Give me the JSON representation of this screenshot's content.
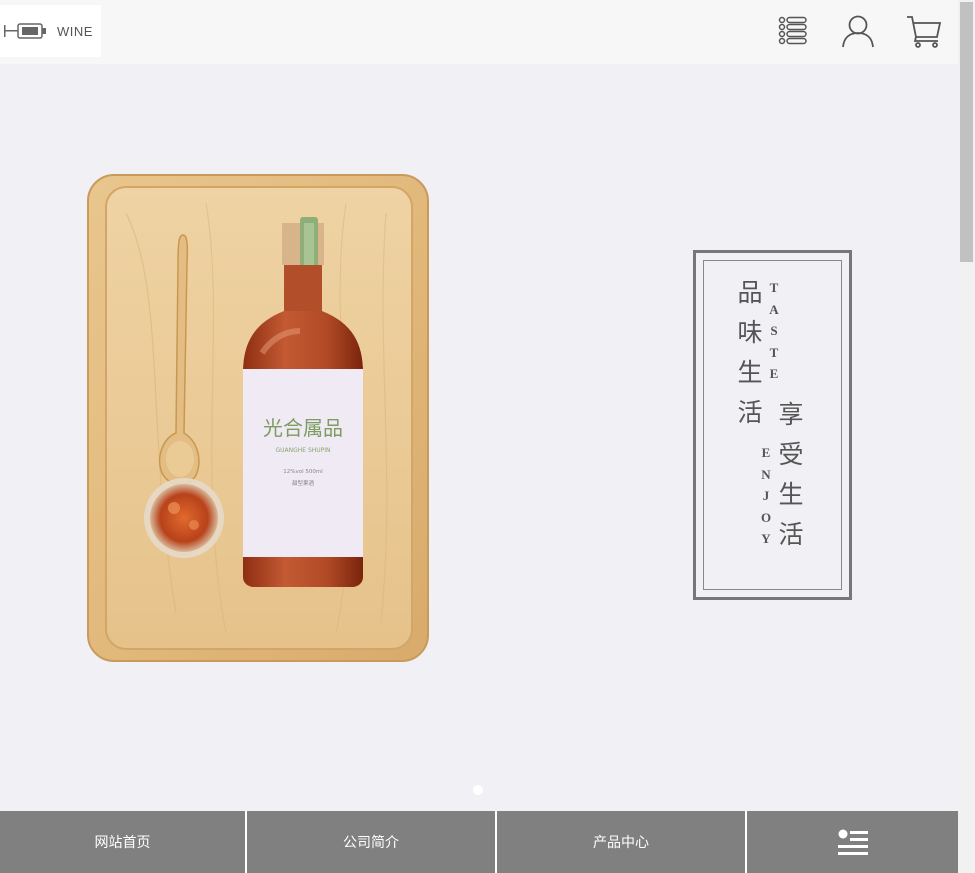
{
  "header": {
    "logo_text": "WINE",
    "icons": [
      "list-menu-icon",
      "user-icon",
      "cart-icon"
    ]
  },
  "hero": {
    "photo": "wine-bottle-on-wooden-tray",
    "bottle_label": {
      "brand": "光合属品",
      "sub": "GUANGHE SHUPIN",
      "spec": "12%vol 500ml",
      "note": "甜型果酒"
    },
    "slogan": {
      "line1_cn": "品味生活",
      "line1_en": "TASTE",
      "line2_cn": "享受生活",
      "line2_en": "ENJOY"
    },
    "carousel_active_index": 0
  },
  "bottom_nav": {
    "items": [
      "网站首页",
      "公司简介",
      "产品中心"
    ],
    "menu_icon": "menu-icon"
  },
  "colors": {
    "header_bg": "#f7f7f7",
    "hero_bg": "#f0f0f5",
    "nav_bg": "#808080",
    "frame": "#777777"
  }
}
